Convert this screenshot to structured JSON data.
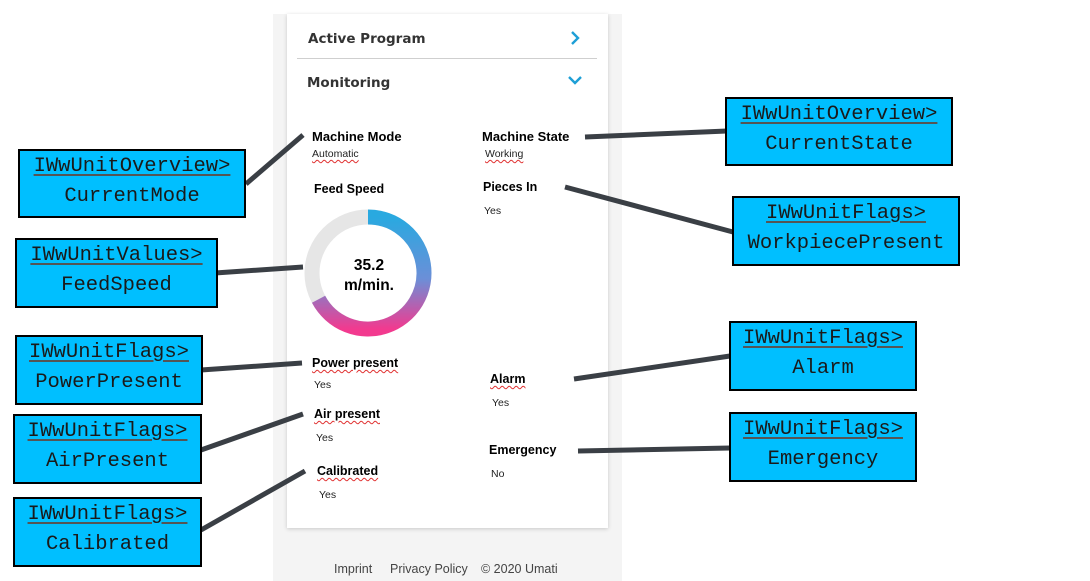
{
  "sections": {
    "active_program": "Active Program",
    "monitoring": "Monitoring"
  },
  "fields": {
    "machine_mode": {
      "label": "Machine Mode",
      "value": "Automatic"
    },
    "machine_state": {
      "label": "Machine State",
      "value": "Working"
    },
    "feed_speed": {
      "label": "Feed Speed",
      "value": "35.2",
      "unit": "m/min."
    },
    "pieces_in": {
      "label": "Pieces In",
      "value": "Yes"
    },
    "power_present": {
      "label": "Power present",
      "value": "Yes"
    },
    "alarm": {
      "label": "Alarm",
      "value": "Yes"
    },
    "air_present": {
      "label": "Air present",
      "value": "Yes"
    },
    "emergency": {
      "label": "Emergency",
      "value": "No"
    },
    "calibrated": {
      "label": "Calibrated",
      "value": "Yes"
    }
  },
  "footer": {
    "imprint": "Imprint",
    "privacy": "Privacy Policy",
    "copyright": "© 2020 Umati"
  },
  "callouts": {
    "current_mode": {
      "line1": "IWwUnitOverview>",
      "line2": "CurrentMode"
    },
    "current_state": {
      "line1": "IWwUnitOverview>",
      "line2": "CurrentState"
    },
    "feed_speed": {
      "line1": "IWwUnitValues>",
      "line2": "FeedSpeed"
    },
    "workpiece_present": {
      "line1": "IWwUnitFlags>",
      "line2": "WorkpiecePresent"
    },
    "power_present": {
      "line1": "IWwUnitFlags>",
      "line2": "PowerPresent"
    },
    "alarm": {
      "line1": "IWwUnitFlags>",
      "line2": "Alarm"
    },
    "air_present": {
      "line1": "IWwUnitFlags>",
      "line2": "AirPresent"
    },
    "emergency": {
      "line1": "IWwUnitFlags>",
      "line2": "Emergency"
    },
    "calibrated": {
      "line1": "IWwUnitFlags>",
      "line2": "Calibrated"
    }
  },
  "colors": {
    "callout_fill": "#00bfff",
    "connector": "#3a3f45",
    "gauge_track": "#e6e6e6",
    "gauge_start": "#29a9e0",
    "gauge_end": "#f23a8f",
    "chevron": "#1e9fd6"
  }
}
